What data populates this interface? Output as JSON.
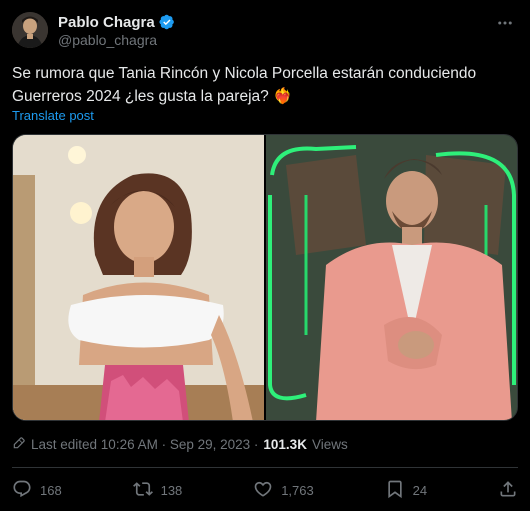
{
  "author": {
    "name": "Pablo Chagra",
    "handle": "@pablo_chagra"
  },
  "tweet": {
    "text": "Se rumora que Tania Rincón y Nicola Porcella estarán conduciendo Guerreros 2024 ¿les gusta la pareja? ❤️‍🔥",
    "translate_label": "Translate post"
  },
  "meta": {
    "edited_label": "Last edited 10:26 AM · Sep 29, 2023 ·",
    "views_count": "101.3K",
    "views_label": "Views"
  },
  "actions": {
    "replies": "168",
    "reposts": "138",
    "likes": "1,763",
    "bookmarks": "24"
  },
  "colors": {
    "background": "#000000",
    "text": "#e7e9ea",
    "muted": "#71767b",
    "accent": "#1d9bf0",
    "border": "#2f3336"
  },
  "icons": [
    "verified-badge-icon",
    "more-icon",
    "edit-icon",
    "reply-icon",
    "repost-icon",
    "like-icon",
    "bookmark-icon",
    "share-icon"
  ]
}
